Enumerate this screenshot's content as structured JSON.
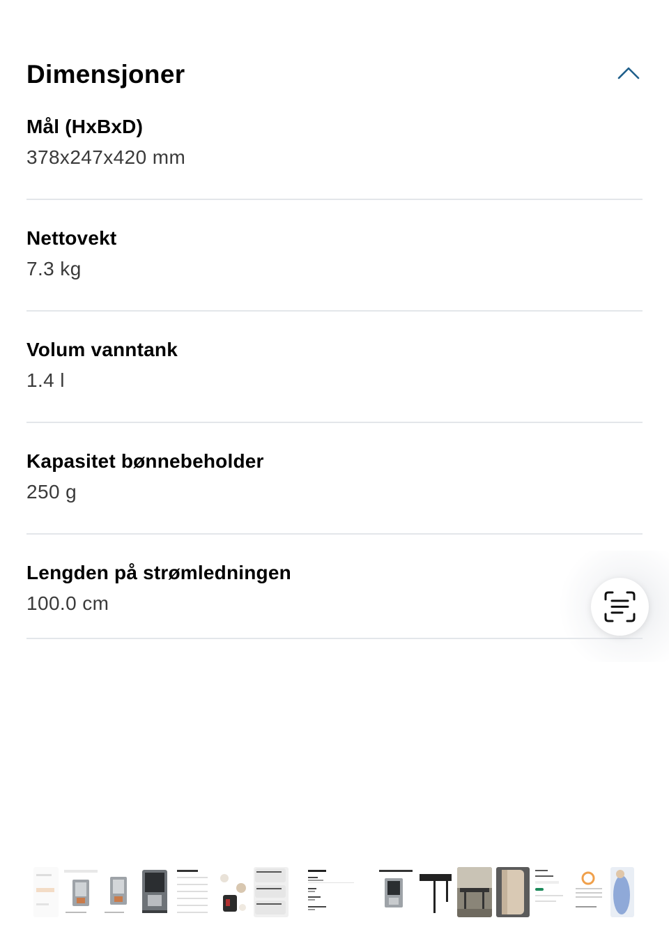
{
  "section": {
    "title": "Dimensjoner",
    "collapse_icon": "chevron-up-icon"
  },
  "specs": [
    {
      "label": "Mål (HxBxD)",
      "value": "378x247x420 mm"
    },
    {
      "label": "Nettovekt",
      "value": "7.3 kg"
    },
    {
      "label": "Volum vanntank",
      "value": "1.4 l"
    },
    {
      "label": "Kapasitet bønnebeholder",
      "value": "250 g"
    },
    {
      "label": "Lengden på strømledningen",
      "value": "100.0 cm"
    }
  ],
  "scan_button": {
    "icon": "scan-text-icon"
  },
  "thumbnail_strip": {
    "description_icon": "screenshot-thumbnails",
    "accent": "#1f5f8b"
  }
}
